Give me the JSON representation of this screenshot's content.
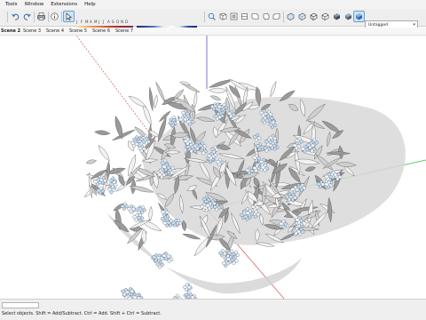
{
  "menu": [
    {
      "id": "tools",
      "label": "Tools"
    },
    {
      "id": "window",
      "label": "Window"
    },
    {
      "id": "extensions",
      "label": "Extensions"
    },
    {
      "id": "help",
      "label": "Help"
    }
  ],
  "shadow_settings": {
    "months": [
      "J",
      "F",
      "M",
      "A",
      "M",
      "J",
      "J",
      "A",
      "S",
      "O",
      "N",
      "D"
    ],
    "time_start": "07:55 AM",
    "time_noon": "Noon",
    "time_end": "04:33 PM"
  },
  "layer_dropdown": {
    "value": "Untagged"
  },
  "scenes": [
    {
      "label": "Scene 2",
      "active": true
    },
    {
      "label": "Scene 3",
      "active": false
    },
    {
      "label": "Scene 4",
      "active": false
    },
    {
      "label": "Scene 5",
      "active": false
    },
    {
      "label": "Scene 6",
      "active": false
    },
    {
      "label": "Scene 7",
      "active": false
    }
  ],
  "status": {
    "hint": "Select objects. Shift = Add/Subtract. Ctrl = Add. Shift + Ctrl = Subtract."
  },
  "colors": {
    "axis_red": "#d04040",
    "axis_green": "#3cb43c",
    "axis_blue": "#3c3cd0",
    "petal_blue": "#c9dcef",
    "leaf_grey": "#dcdcdc",
    "shadow": "#cfcfcf"
  },
  "icons": [
    "undo-icon",
    "redo-icon",
    "print-icon",
    "model-info-icon",
    "select-tool-icon",
    "zoom-extents-icon",
    "iso-view-icon",
    "top-view-icon",
    "front-view-icon",
    "right-view-icon",
    "back-view-icon",
    "left-view-icon",
    "xray-icon",
    "back-edges-icon",
    "wireframe-icon",
    "hidden-line-icon",
    "shaded-icon",
    "shaded-textures-icon",
    "monochrome-icon"
  ]
}
